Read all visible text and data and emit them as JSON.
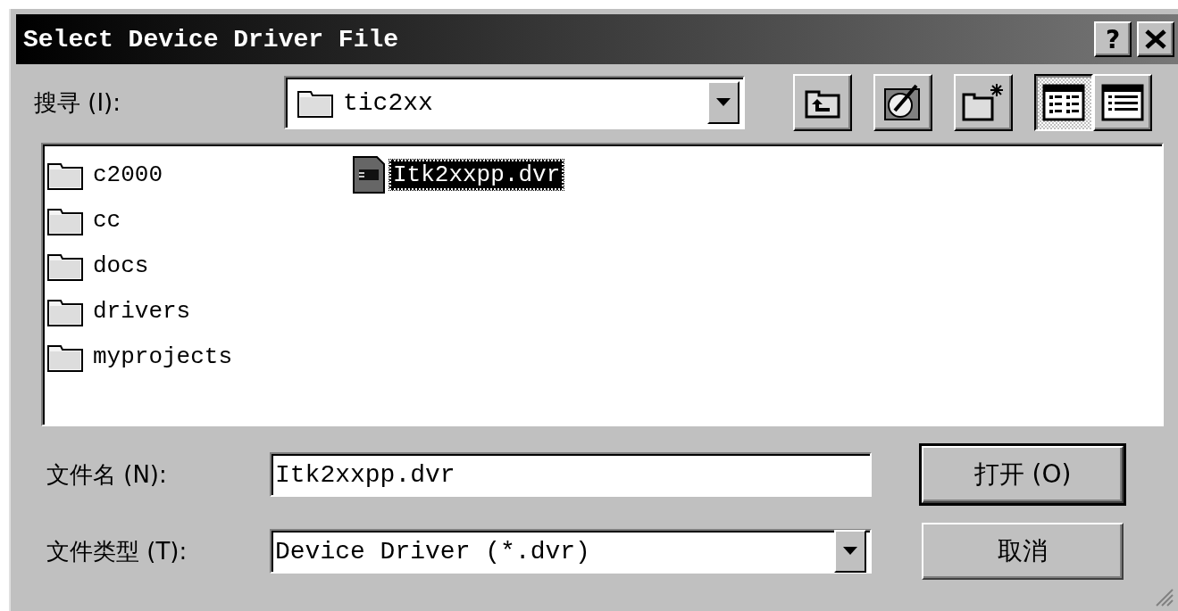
{
  "window": {
    "title": "Select Device Driver File",
    "title_buttons": [
      {
        "kind": "help",
        "text": "?"
      },
      {
        "kind": "close"
      }
    ]
  },
  "look_in": {
    "label": "搜寻 (I):",
    "value": "tic2xx"
  },
  "toolbar": [
    {
      "kind": "up-folder",
      "selected": false
    },
    {
      "kind": "desktop",
      "selected": false
    },
    {
      "kind": "new-folder",
      "selected": false
    },
    {
      "kind": "list-view",
      "selected": true
    },
    {
      "kind": "details-view",
      "selected": false
    }
  ],
  "files": [
    {
      "kind": "folder",
      "name": "c2000",
      "selected": false
    },
    {
      "kind": "folder",
      "name": "cc",
      "selected": false
    },
    {
      "kind": "folder",
      "name": "docs",
      "selected": false
    },
    {
      "kind": "folder",
      "name": "drivers",
      "selected": false
    },
    {
      "kind": "folder",
      "name": "myprojects",
      "selected": false
    },
    {
      "kind": "file",
      "name": "Itk2xxpp.dvr",
      "selected": true
    }
  ],
  "file_name": {
    "label": "文件名 (N):",
    "value": "Itk2xxpp.dvr"
  },
  "file_type": {
    "label": "文件类型 (T):",
    "value": "Device Driver (*.dvr)"
  },
  "buttons": [
    {
      "label": "打开 (O)",
      "default": true
    },
    {
      "label": "取消",
      "default": false
    }
  ]
}
